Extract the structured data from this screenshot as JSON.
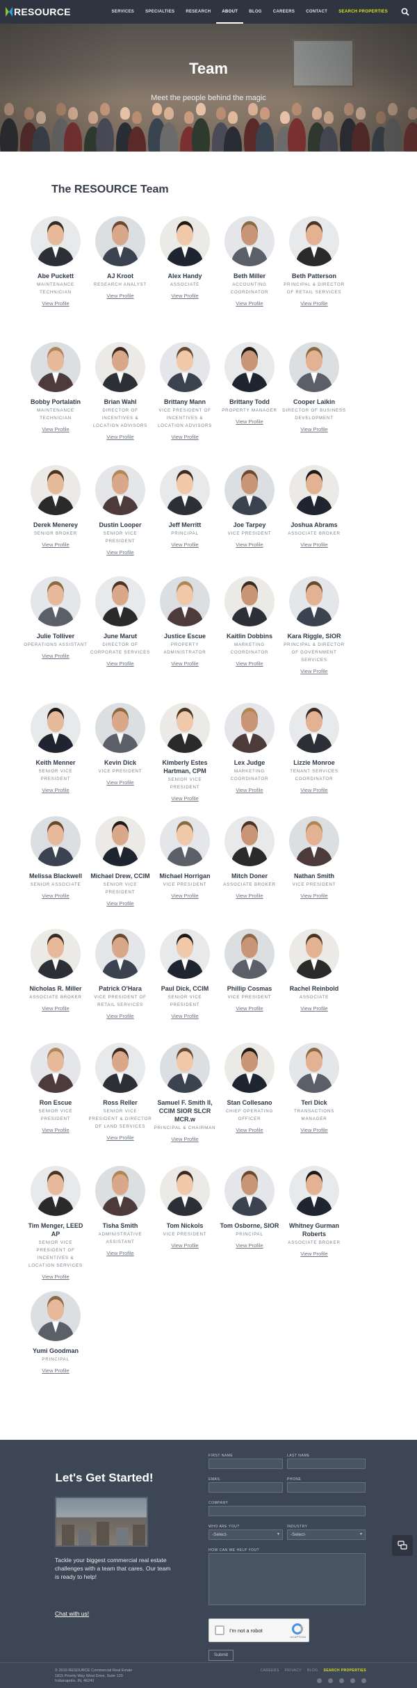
{
  "header": {
    "logo_text": "RESOURCE",
    "nav": [
      {
        "label": "SERVICES"
      },
      {
        "label": "SPECIALTIES"
      },
      {
        "label": "RESEARCH"
      },
      {
        "label": "ABOUT"
      },
      {
        "label": "BLOG"
      },
      {
        "label": "CAREERS"
      },
      {
        "label": "CONTACT"
      },
      {
        "label": "SEARCH PROPERTIES"
      }
    ],
    "search_icon": "search-icon"
  },
  "hero": {
    "title": "Team",
    "subtitle": "Meet the people behind the magic"
  },
  "team": {
    "heading": "The RESOURCE Team",
    "view_label": "View Profile",
    "members": [
      {
        "name": "Abe Puckett",
        "title": "MAINTENANCE TECHNICIAN"
      },
      {
        "name": "AJ Kroot",
        "title": "RESEARCH ANALYST"
      },
      {
        "name": "Alex Handy",
        "title": "ASSOCIATE"
      },
      {
        "name": "Beth Miller",
        "title": "ACCOUNTING COORDINATOR"
      },
      {
        "name": "Beth Patterson",
        "title": "PRINCIPAL & DIRECTOR OF RETAIL SERVICES"
      },
      {
        "name": "Bobby Portalatin",
        "title": "MAINTENANCE TECHNICIAN"
      },
      {
        "name": "Brian Wahl",
        "title": "DIRECTOR OF INCENTIVES & LOCATION ADVISORS"
      },
      {
        "name": "Brittany Mann",
        "title": "VICE PRESIDENT OF INCENTIVES & LOCATION ADVISORS"
      },
      {
        "name": "Brittany Todd",
        "title": "PROPERTY MANAGER"
      },
      {
        "name": "Cooper Laikin",
        "title": "DIRECTOR OF BUSINESS DEVELOPMENT"
      },
      {
        "name": "Derek Menerey",
        "title": "SENIOR BROKER"
      },
      {
        "name": "Dustin Looper",
        "title": "SENIOR VICE PRESIDENT"
      },
      {
        "name": "Jeff Merritt",
        "title": "PRINCIPAL"
      },
      {
        "name": "Joe Tarpey",
        "title": "VICE PRESIDENT"
      },
      {
        "name": "Joshua Abrams",
        "title": "ASSOCIATE BROKER"
      },
      {
        "name": "Julie Tolliver",
        "title": "OPERATIONS ASSISTANT"
      },
      {
        "name": "June Marut",
        "title": "DIRECTOR OF CORPORATE SERVICES"
      },
      {
        "name": "Justice Escue",
        "title": "PROPERTY ADMINISTRATOR"
      },
      {
        "name": "Kaitlin Dobbins",
        "title": "MARKETING COORDINATOR"
      },
      {
        "name": "Kara Riggle, SIOR",
        "title": "PRINCIPAL & DIRECTOR OF GOVERNMENT SERVICES"
      },
      {
        "name": "Keith Menner",
        "title": "SENIOR VICE PRESIDENT"
      },
      {
        "name": "Kevin Dick",
        "title": "VICE PRESIDENT"
      },
      {
        "name": "Kimberly Estes Hartman, CPM",
        "title": "SENIOR VICE PRESIDENT"
      },
      {
        "name": "Lex Judge",
        "title": "MARKETING COORDINATOR"
      },
      {
        "name": "Lizzie Monroe",
        "title": "TENANT SERVICES COORDINATOR"
      },
      {
        "name": "Melissa Blackwell",
        "title": "SENIOR ASSOCIATE"
      },
      {
        "name": "Michael Drew, CCIM",
        "title": "SENIOR VICE PRESIDENT"
      },
      {
        "name": "Michael Horrigan",
        "title": "VICE PRESIDENT"
      },
      {
        "name": "Mitch Doner",
        "title": "ASSOCIATE BROKER"
      },
      {
        "name": "Nathan Smith",
        "title": "VICE PRESIDENT"
      },
      {
        "name": "Nicholas R. Miller",
        "title": "ASSOCIATE BROKER"
      },
      {
        "name": "Patrick O'Hara",
        "title": "VICE PRESIDENT OF RETAIL SERVICES"
      },
      {
        "name": "Paul Dick, CCIM",
        "title": "SENIOR VICE PRESIDENT"
      },
      {
        "name": "Phillip Cosmas",
        "title": "VICE PRESIDENT"
      },
      {
        "name": "Rachel Reinbold",
        "title": "ASSOCIATE"
      },
      {
        "name": "Ron Escue",
        "title": "SENIOR VICE PRESIDENT"
      },
      {
        "name": "Ross Reller",
        "title": "SENIOR VICE PRESIDENT & DIRECTOR OF LAND SERVICES"
      },
      {
        "name": "Samuel F. Smith II, CCIM SIOR SLCR MCR.w",
        "title": "PRINCIPAL & CHAIRMAN"
      },
      {
        "name": "Stan Collesano",
        "title": "CHIEF OPERATING OFFICER"
      },
      {
        "name": "Teri Dick",
        "title": "TRANSACTIONS MANAGER"
      },
      {
        "name": "Tim Menger, LEED AP",
        "title": "SENIOR VICE PRESIDENT OF INCENTIVES & LOCATION SERVICES"
      },
      {
        "name": "Tisha Smith",
        "title": "ADMINISTRATIVE ASSISTANT"
      },
      {
        "name": "Tom Nickols",
        "title": "VICE PRESIDENT"
      },
      {
        "name": "Tom Osborne, SIOR",
        "title": "PRINCIPAL"
      },
      {
        "name": "Whitney Gurman Roberts",
        "title": "ASSOCIATE BROKER"
      },
      {
        "name": "Yumi Goodman",
        "title": "PRINCIPAL"
      }
    ]
  },
  "contact": {
    "heading": "Let's Get Started!",
    "copy": "Tackle your biggest commercial real estate challenges with a team that cares. Our team is ready to help!",
    "chat_link": "Chat with us!",
    "form": {
      "first_name": "FIRST NAME",
      "last_name": "LAST NAME",
      "email": "EMAIL",
      "phone": "PHONE",
      "company": "COMPANY",
      "who_are_you": "WHO ARE YOU?",
      "industry": "INDUSTRY",
      "who_placeholder": "-Select-",
      "industry_placeholder": "-Select-",
      "help": "HOW CAN WE HELP YOU?",
      "captcha": "I'm not a robot",
      "captcha_brand": "reCAPTCHA",
      "submit": "Submit"
    },
    "footer": {
      "copyright": "© 2019 RESOURCE Commercial Real Estate",
      "address1": "1815 Priority Way West Drive, Suite 120",
      "address2": "Indianapolis, IN, 46240",
      "links": [
        "CAREERS",
        "PRIVACY",
        "BLOG",
        "SEARCH PROPERTIES"
      ]
    }
  }
}
